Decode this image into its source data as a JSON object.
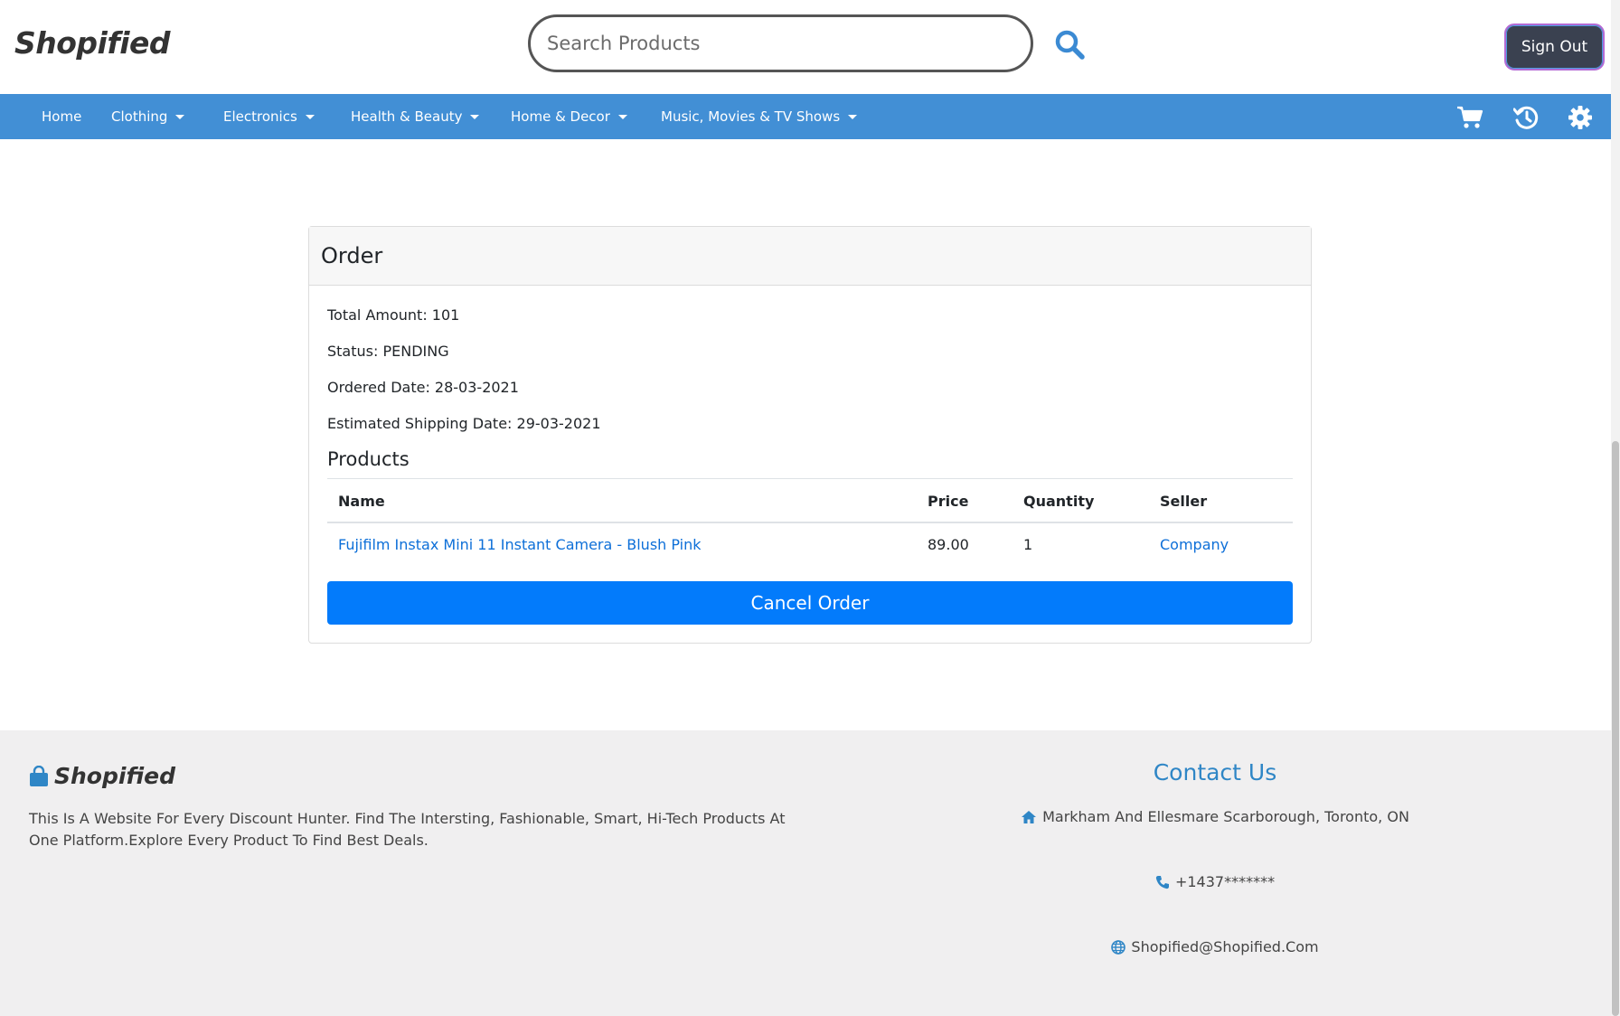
{
  "header": {
    "logo": "Shopified",
    "search_placeholder": "Search Products",
    "search_value": "",
    "signout_label": "Sign Out"
  },
  "nav": {
    "items": [
      {
        "label": "Home",
        "dropdown": false
      },
      {
        "label": "Clothing",
        "dropdown": true
      },
      {
        "label": "Electronics",
        "dropdown": true
      },
      {
        "label": "Health & Beauty",
        "dropdown": true
      },
      {
        "label": "Home & Decor",
        "dropdown": true
      },
      {
        "label": "Music, Movies & TV Shows",
        "dropdown": true
      }
    ],
    "icons": [
      "cart-icon",
      "history-icon",
      "gear-icon"
    ]
  },
  "order": {
    "title": "Order",
    "total_amount": "Total Amount: 101",
    "status": "Status: PENDING",
    "ordered_date": "Ordered Date: 28-03-2021",
    "shipping_date": "Estimated Shipping Date: 29-03-2021",
    "products_title": "Products",
    "table": {
      "headers": [
        "Name",
        "Price",
        "Quantity",
        "Seller"
      ],
      "rows": [
        {
          "name": "Fujifilm Instax Mini 11 Instant Camera - Blush Pink",
          "price": "89.00",
          "quantity": "1",
          "seller": "Company"
        }
      ]
    },
    "cancel_label": "Cancel Order"
  },
  "footer": {
    "logo": "Shopified",
    "description": "This Is A Website For Every Discount Hunter. Find The Intersting, Fashionable, Smart, Hi-Tech Products At One Platform.Explore Every Product To Find Best Deals.",
    "contact_title": "Contact Us",
    "address": "Markham And Ellesmare Scarborough, Toronto, ON",
    "phone": "+1437*******",
    "email": "Shopified@Shopified.Com"
  },
  "colors": {
    "nav_bg": "#428fd5",
    "primary_button": "#037bfb",
    "link": "#0d6fd8",
    "footer_bg": "#f0eff0",
    "contact_title": "#2f86c6"
  }
}
